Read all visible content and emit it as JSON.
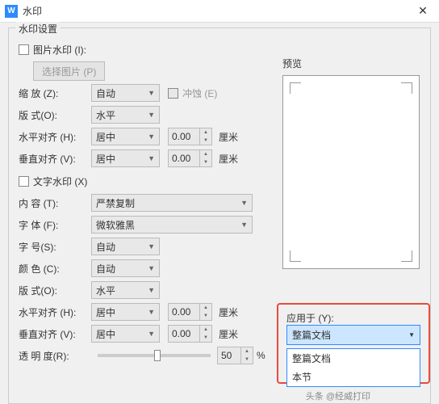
{
  "title": "水印",
  "section_title": "水印设置",
  "image_wm": {
    "checkbox_label": "图片水印 (I):",
    "select_btn": "选择图片 (P)",
    "scale_label": "缩   放 (Z):",
    "scale_val": "自动",
    "washout": "冲蚀 (E)",
    "layout_label": "版   式(O):",
    "layout_val": "水平",
    "halign_label": "水平对齐 (H):",
    "halign_val": "居中",
    "halign_num": "0.00",
    "valign_label": "垂直对齐 (V):",
    "valign_val": "居中",
    "valign_num": "0.00",
    "unit": "厘米"
  },
  "text_wm": {
    "checkbox_label": "文字水印 (X)",
    "content_label": "内   容 (T):",
    "content_val": "严禁复制",
    "font_label": "字   体 (F):",
    "font_val": "微软雅黑",
    "size_label": "字   号(S):",
    "size_val": "自动",
    "color_label": "颜   色 (C):",
    "color_val": "自动",
    "layout_label": "版   式(O):",
    "layout_val": "水平",
    "halign_label": "水平对齐 (H):",
    "halign_val": "居中",
    "halign_num": "0.00",
    "valign_label": "垂直对齐 (V):",
    "valign_val": "居中",
    "valign_num": "0.00",
    "opacity_label": "透 明 度(R):",
    "opacity_val": "50",
    "pct": "%",
    "unit": "厘米"
  },
  "preview_label": "预览",
  "apply": {
    "label": "应用于 (Y):",
    "selected": "整篇文档",
    "opt1": "整篇文档",
    "opt2": "本节"
  },
  "footer": "头条 @经威打印"
}
